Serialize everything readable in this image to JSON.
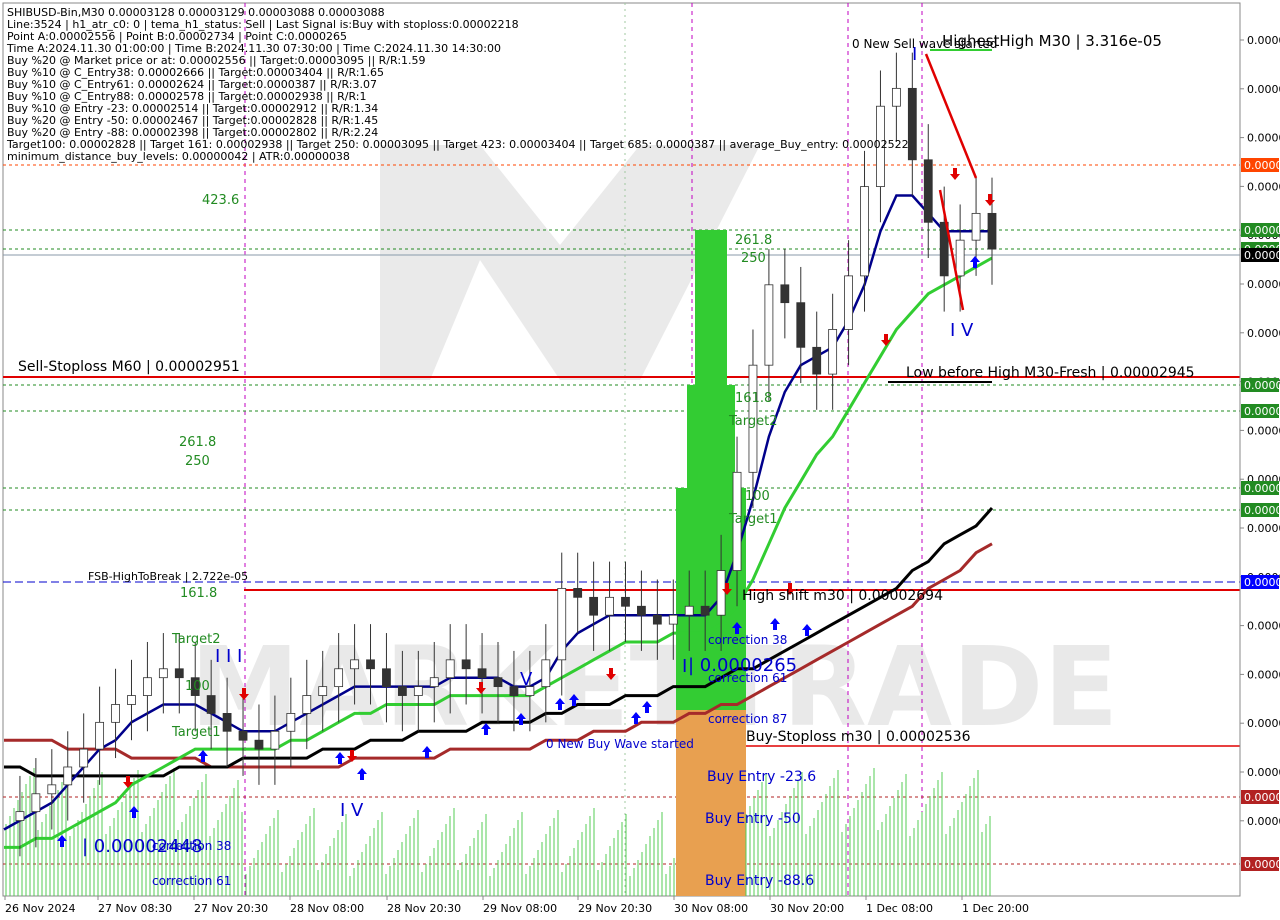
{
  "chart_data": {
    "type": "line",
    "instrument": "SHIBUSD-Bin,M30",
    "info_lines": [
      "SHIBUSD-Bin,M30  0.00003128 0.00003129 0.00003088 0.00003088",
      "Line:3524 | h1_atr_c0: 0 | tema_h1_status: Sell | Last Signal is:Buy with stoploss:0.00002218",
      "Point A:0.00002556 | Point B:0.00002734 | Point C:0.0000265",
      "Time A:2024.11.30 01:00:00 | Time B:2024.11.30 07:30:00 | Time C:2024.11.30 14:30:00",
      "Buy %20 @ Market price or at: 0.00002556 || Target:0.00003095 || R/R:1.59",
      "Buy %10 @ C_Entry38: 0.00002666 || Target:0.00003404 || R/R:1.65",
      "Buy %10 @ C_Entry61: 0.00002624 || Target:0.0000387 || R/R:3.07",
      "Buy %10 @ C_Entry88: 0.00002578 || Target:0.00002938 || R/R:1",
      "Buy %10 @ Entry -23: 0.00002514 || Target:0.00002912 || R/R:1.34",
      "Buy %20 @ Entry -50: 0.00002467 || Target:0.00002828 || R/R:1.45",
      "Buy %20 @ Entry -88: 0.00002398 || Target:0.00002802 || R/R:2.24",
      "Target100: 0.00002828 || Target 161: 0.00002938 || Target 250: 0.00003095 || Target 423: 0.00003404 || Target 685: 0.0000387 || average_Buy_entry: 0.00002522",
      "minimum_distance_buy_levels: 0.00000042 | ATR:0.00000038"
    ],
    "x_tick_labels": [
      "26 Nov 2024",
      "27 Nov 08:30",
      "27 Nov 20:30",
      "28 Nov 08:00",
      "28 Nov 20:30",
      "29 Nov 08:00",
      "29 Nov 20:30",
      "30 Nov 08:00",
      "30 Nov 20:00",
      "1 Dec 08:00",
      "1 Dec 20:00"
    ],
    "y_tick_labels": [
      "0.0000",
      "0.0000",
      "0.0000",
      "0.0000",
      "0.0000",
      "0.0000",
      "0.0000",
      "0.0000",
      "0.0000",
      "0.0000",
      "0.0000",
      "0.0000",
      "0.0000",
      "0.0000",
      "0.0000",
      "0.0000",
      "0.0000"
    ],
    "price_tags": [
      {
        "text": "0.0000",
        "color": "#ff4500"
      },
      {
        "text": "0.0000",
        "color": "#228b22"
      },
      {
        "text": "0.0000",
        "color": "#228b22"
      },
      {
        "text": "0.0000",
        "color": "#000000"
      },
      {
        "text": "0.0000",
        "color": "#228b22"
      },
      {
        "text": "0.0000",
        "color": "#228b22"
      },
      {
        "text": "0.0000",
        "color": "#228b22"
      },
      {
        "text": "0.0000",
        "color": "#228b22"
      },
      {
        "text": "0.0000",
        "color": "#0000ff"
      },
      {
        "text": "0.0000",
        "color": "#b22222"
      },
      {
        "text": "0.0000",
        "color": "#b22222"
      }
    ],
    "levels": [
      {
        "label": "Sell-Stoploss M60 | 0.00002951",
        "value": 2.951e-05,
        "color": "#e00000"
      },
      {
        "label": "Low before High   M30-Fresh | 0.00002945",
        "value": 2.945e-05,
        "color": "#000000"
      },
      {
        "label": "HighestHigh   M30 | 3.316e-05",
        "value": 3.316e-05,
        "color": "#000000"
      },
      {
        "label": "High shift m30 | 0.00002694",
        "value": 2.694e-05,
        "color": "#e00000"
      },
      {
        "label": "Buy-Stoploss m30 | 0.00002536",
        "value": 2.536e-05,
        "color": "#e00000"
      },
      {
        "label": "FSB-HighToBreak | 2.722e-05",
        "value": 2.722e-05,
        "color": "#0000cd"
      }
    ],
    "fib_labels_left": [
      "423.6",
      "261.8",
      "250",
      "161.8",
      "Target2",
      "100",
      "Target1"
    ],
    "fib_labels_mid": [
      "261.8",
      "250",
      "161.8",
      "Target2",
      "100",
      "Target1"
    ],
    "zone_labels": [
      "correction 38",
      "correction 61",
      "correction 87",
      "Buy Entry -23.6",
      "Buy Entry -50",
      "Buy Entry -88.6"
    ],
    "left_zone_labels": [
      "correction 38",
      "correction 61"
    ],
    "wave_labels": [
      {
        "text": "0 New Sell wave started"
      },
      {
        "text": "0 New Buy Wave started"
      },
      {
        "text": "I V"
      },
      {
        "text": "I V"
      },
      {
        "text": "I I I"
      },
      {
        "text": "V"
      },
      {
        "text": "I"
      },
      {
        "text": "I"
      }
    ],
    "point_labels": [
      {
        "text": "| 0.00002448",
        "color": "#0000cd"
      },
      {
        "text": "| 0.0000265",
        "color": "#0000cd"
      }
    ],
    "watermark": "MARKETTRADE",
    "price_series": [
      2.45e-05,
      2.46e-05,
      2.48e-05,
      2.49e-05,
      2.51e-05,
      2.53e-05,
      2.56e-05,
      2.58e-05,
      2.59e-05,
      2.61e-05,
      2.62e-05,
      2.61e-05,
      2.59e-05,
      2.57e-05,
      2.55e-05,
      2.54e-05,
      2.53e-05,
      2.55e-05,
      2.57e-05,
      2.59e-05,
      2.6e-05,
      2.62e-05,
      2.63e-05,
      2.62e-05,
      2.6e-05,
      2.59e-05,
      2.6e-05,
      2.61e-05,
      2.63e-05,
      2.62e-05,
      2.61e-05,
      2.6e-05,
      2.59e-05,
      2.6e-05,
      2.63e-05,
      2.71e-05,
      2.7e-05,
      2.68e-05,
      2.7e-05,
      2.69e-05,
      2.68e-05,
      2.67e-05,
      2.68e-05,
      2.69e-05,
      2.68e-05,
      2.73e-05,
      2.84e-05,
      2.96e-05,
      3.05e-05,
      3.03e-05,
      2.98e-05,
      2.95e-05,
      3e-05,
      3.06e-05,
      3.16e-05,
      3.25e-05,
      3.27e-05,
      3.19e-05,
      3.12e-05,
      3.06e-05,
      3.1e-05,
      3.13e-05,
      3.09e-05
    ],
    "ma_blue": [
      2.44e-05,
      2.45e-05,
      2.46e-05,
      2.47e-05,
      2.49e-05,
      2.51e-05,
      2.53e-05,
      2.54e-05,
      2.56e-05,
      2.57e-05,
      2.58e-05,
      2.58e-05,
      2.58e-05,
      2.57e-05,
      2.56e-05,
      2.55e-05,
      2.55e-05,
      2.55e-05,
      2.56e-05,
      2.57e-05,
      2.58e-05,
      2.59e-05,
      2.6e-05,
      2.6e-05,
      2.6e-05,
      2.6e-05,
      2.6e-05,
      2.6e-05,
      2.61e-05,
      2.61e-05,
      2.61e-05,
      2.61e-05,
      2.6e-05,
      2.6e-05,
      2.61e-05,
      2.64e-05,
      2.66e-05,
      2.67e-05,
      2.68e-05,
      2.68e-05,
      2.68e-05,
      2.68e-05,
      2.68e-05,
      2.68e-05,
      2.68e-05,
      2.7e-05,
      2.75e-05,
      2.81e-05,
      2.88e-05,
      2.93e-05,
      2.96e-05,
      2.97e-05,
      2.98e-05,
      3.01e-05,
      3.05e-05,
      3.11e-05,
      3.15e-05,
      3.15e-05,
      3.13e-05,
      3.11e-05,
      3.11e-05,
      3.11e-05,
      3.11e-05
    ],
    "ma_green": [
      2.42e-05,
      2.42e-05,
      2.43e-05,
      2.43e-05,
      2.44e-05,
      2.45e-05,
      2.46e-05,
      2.47e-05,
      2.49e-05,
      2.5e-05,
      2.51e-05,
      2.52e-05,
      2.53e-05,
      2.53e-05,
      2.53e-05,
      2.53e-05,
      2.53e-05,
      2.53e-05,
      2.54e-05,
      2.54e-05,
      2.55e-05,
      2.56e-05,
      2.57e-05,
      2.57e-05,
      2.58e-05,
      2.58e-05,
      2.58e-05,
      2.58e-05,
      2.59e-05,
      2.59e-05,
      2.59e-05,
      2.59e-05,
      2.59e-05,
      2.59e-05,
      2.6e-05,
      2.61e-05,
      2.62e-05,
      2.63e-05,
      2.64e-05,
      2.65e-05,
      2.65e-05,
      2.65e-05,
      2.66e-05,
      2.66e-05,
      2.66e-05,
      2.67e-05,
      2.69e-05,
      2.72e-05,
      2.76e-05,
      2.8e-05,
      2.83e-05,
      2.86e-05,
      2.88e-05,
      2.91e-05,
      2.94e-05,
      2.97e-05,
      3e-05,
      3.02e-05,
      3.04e-05,
      3.05e-05,
      3.06e-05,
      3.07e-05,
      3.08e-05
    ],
    "ma_black": [
      2.51e-05,
      2.51e-05,
      2.5e-05,
      2.5e-05,
      2.5e-05,
      2.5e-05,
      2.5e-05,
      2.5e-05,
      2.5e-05,
      2.5e-05,
      2.5e-05,
      2.51e-05,
      2.51e-05,
      2.51e-05,
      2.51e-05,
      2.52e-05,
      2.52e-05,
      2.52e-05,
      2.52e-05,
      2.52e-05,
      2.53e-05,
      2.53e-05,
      2.53e-05,
      2.54e-05,
      2.54e-05,
      2.54e-05,
      2.55e-05,
      2.55e-05,
      2.55e-05,
      2.55e-05,
      2.56e-05,
      2.56e-05,
      2.56e-05,
      2.56e-05,
      2.57e-05,
      2.57e-05,
      2.58e-05,
      2.58e-05,
      2.58e-05,
      2.59e-05,
      2.59e-05,
      2.59e-05,
      2.6e-05,
      2.6e-05,
      2.6e-05,
      2.61e-05,
      2.62e-05,
      2.62e-05,
      2.63e-05,
      2.64e-05,
      2.65e-05,
      2.66e-05,
      2.67e-05,
      2.68e-05,
      2.69e-05,
      2.7e-05,
      2.71e-05,
      2.73e-05,
      2.74e-05,
      2.76e-05,
      2.77e-05,
      2.78e-05,
      2.8e-05
    ],
    "ma_brown": [
      2.54e-05,
      2.54e-05,
      2.54e-05,
      2.54e-05,
      2.53e-05,
      2.53e-05,
      2.53e-05,
      2.53e-05,
      2.52e-05,
      2.52e-05,
      2.52e-05,
      2.52e-05,
      2.52e-05,
      2.51e-05,
      2.51e-05,
      2.51e-05,
      2.51e-05,
      2.51e-05,
      2.51e-05,
      2.51e-05,
      2.51e-05,
      2.51e-05,
      2.52e-05,
      2.52e-05,
      2.52e-05,
      2.52e-05,
      2.52e-05,
      2.52e-05,
      2.53e-05,
      2.53e-05,
      2.53e-05,
      2.53e-05,
      2.53e-05,
      2.53e-05,
      2.54e-05,
      2.54e-05,
      2.54e-05,
      2.55e-05,
      2.55e-05,
      2.55e-05,
      2.56e-05,
      2.56e-05,
      2.56e-05,
      2.57e-05,
      2.57e-05,
      2.58e-05,
      2.58e-05,
      2.59e-05,
      2.6e-05,
      2.61e-05,
      2.62e-05,
      2.63e-05,
      2.64e-05,
      2.65e-05,
      2.66e-05,
      2.67e-05,
      2.68e-05,
      2.69e-05,
      2.71e-05,
      2.72e-05,
      2.73e-05,
      2.75e-05,
      2.76e-05
    ],
    "y_range": [
      2.37e-05,
      3.36e-05
    ],
    "grid": true,
    "colors": {
      "up": "#2e8b57",
      "down": "#b22222",
      "blue_ma": "#00008b",
      "green_ma": "#32cd32",
      "black_ma": "#000000",
      "brown_ma": "#a52a2a",
      "zone_green": "#33cc33",
      "zone_orange": "#e8a050"
    }
  }
}
